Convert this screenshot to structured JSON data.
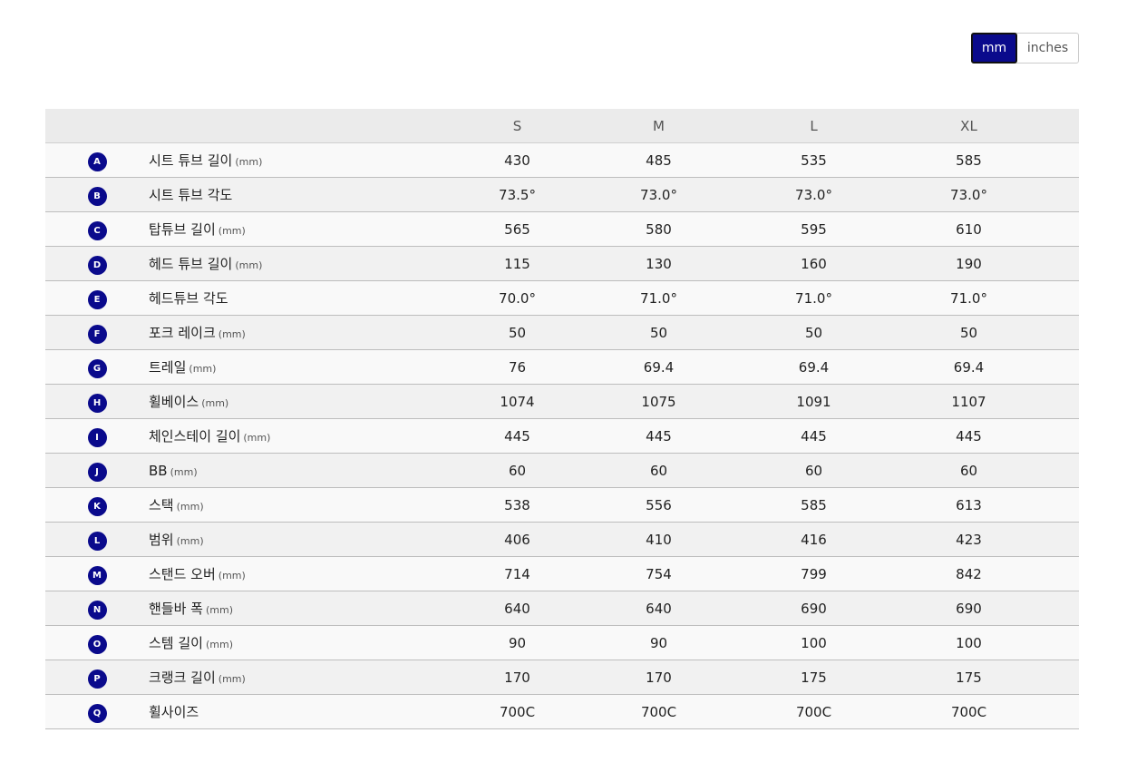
{
  "unit_toggle": {
    "mm_label": "mm",
    "inches_label": "inches",
    "selected": "mm"
  },
  "colors": {
    "accent": "#0a0a8c",
    "header_bg": "#ebebeb"
  },
  "sizes": [
    "S",
    "M",
    "L",
    "XL"
  ],
  "rows": [
    {
      "badge": "A",
      "label": "시트 튜브 길이",
      "unit": "(mm)",
      "values": [
        "430",
        "485",
        "535",
        "585"
      ]
    },
    {
      "badge": "B",
      "label": "시트 튜브 각도",
      "unit": "",
      "values": [
        "73.5°",
        "73.0°",
        "73.0°",
        "73.0°"
      ]
    },
    {
      "badge": "C",
      "label": "탑튜브 길이",
      "unit": "(mm)",
      "values": [
        "565",
        "580",
        "595",
        "610"
      ]
    },
    {
      "badge": "D",
      "label": "헤드 튜브 길이",
      "unit": "(mm)",
      "values": [
        "115",
        "130",
        "160",
        "190"
      ]
    },
    {
      "badge": "E",
      "label": "헤드튜브 각도",
      "unit": "",
      "values": [
        "70.0°",
        "71.0°",
        "71.0°",
        "71.0°"
      ]
    },
    {
      "badge": "F",
      "label": "포크 레이크",
      "unit": "(mm)",
      "values": [
        "50",
        "50",
        "50",
        "50"
      ]
    },
    {
      "badge": "G",
      "label": "트레일",
      "unit": "(mm)",
      "values": [
        "76",
        "69.4",
        "69.4",
        "69.4"
      ]
    },
    {
      "badge": "H",
      "label": "휠베이스",
      "unit": "(mm)",
      "values": [
        "1074",
        "1075",
        "1091",
        "1107"
      ]
    },
    {
      "badge": "I",
      "label": "체인스테이 길이",
      "unit": "(mm)",
      "values": [
        "445",
        "445",
        "445",
        "445"
      ]
    },
    {
      "badge": "J",
      "label": "BB",
      "unit": "(mm)",
      "values": [
        "60",
        "60",
        "60",
        "60"
      ]
    },
    {
      "badge": "K",
      "label": "스택",
      "unit": "(mm)",
      "values": [
        "538",
        "556",
        "585",
        "613"
      ]
    },
    {
      "badge": "L",
      "label": "범위",
      "unit": "(mm)",
      "values": [
        "406",
        "410",
        "416",
        "423"
      ]
    },
    {
      "badge": "M",
      "label": "스탠드 오버",
      "unit": "(mm)",
      "values": [
        "714",
        "754",
        "799",
        "842"
      ]
    },
    {
      "badge": "N",
      "label": "핸들바 폭",
      "unit": "(mm)",
      "values": [
        "640",
        "640",
        "690",
        "690"
      ]
    },
    {
      "badge": "O",
      "label": "스템 길이",
      "unit": "(mm)",
      "values": [
        "90",
        "90",
        "100",
        "100"
      ]
    },
    {
      "badge": "P",
      "label": "크랭크 길이",
      "unit": "(mm)",
      "values": [
        "170",
        "170",
        "175",
        "175"
      ]
    },
    {
      "badge": "Q",
      "label": "휠사이즈",
      "unit": "",
      "values": [
        "700C",
        "700C",
        "700C",
        "700C"
      ]
    }
  ]
}
